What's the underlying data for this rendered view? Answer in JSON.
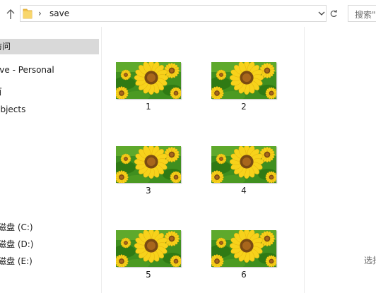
{
  "address_bar": {
    "up_icon": "arrow-up-icon",
    "folder_icon": "folder-icon",
    "path": [
      "save"
    ],
    "dropdown_icon": "chevron-down-icon",
    "refresh_icon": "refresh-icon"
  },
  "search": {
    "placeholder": "搜索\""
  },
  "nav": {
    "items": [
      {
        "label": "访问",
        "selected": true
      },
      {
        "label": "rive - Personal",
        "selected": false
      },
      {
        "label": "百",
        "selected": false
      },
      {
        "label": "Objects",
        "selected": false
      }
    ],
    "drives": [
      {
        "label": "磁盘 (C:)"
      },
      {
        "label": "磁盘 (D:)"
      },
      {
        "label": "磁盘 (E:)"
      }
    ]
  },
  "files": [
    {
      "name": "1",
      "icon": "sunflower-thumbnail"
    },
    {
      "name": "2",
      "icon": "sunflower-thumbnail"
    },
    {
      "name": "3",
      "icon": "sunflower-thumbnail"
    },
    {
      "name": "4",
      "icon": "sunflower-thumbnail"
    },
    {
      "name": "5",
      "icon": "sunflower-thumbnail"
    },
    {
      "name": "6",
      "icon": "sunflower-thumbnail"
    }
  ],
  "preview": {
    "text": "选择"
  },
  "colors": {
    "selection": "#d9d9d9",
    "folder": "#f3c24a",
    "petal": "#f7d21b",
    "leaf": "#3f8f1f",
    "center": "#7a4a12"
  }
}
